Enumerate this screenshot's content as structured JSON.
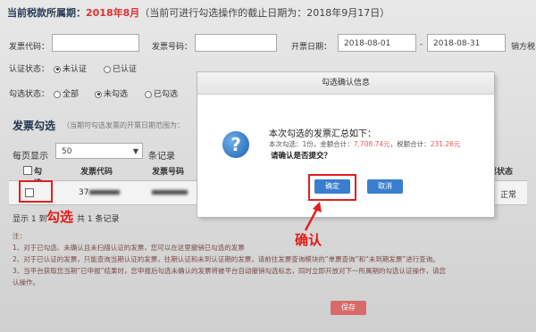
{
  "header": {
    "period_label": "当前税款所属期：",
    "period_value": "2018年8月",
    "period_note": "（当前可进行勾选操作的截止日期为：2018年9月17日）"
  },
  "filters": {
    "invoice_code_label": "发票代码：",
    "invoice_code_value": "",
    "invoice_number_label": "发票号码：",
    "invoice_number_value": "",
    "issue_date_label": "开票日期：",
    "date_from": "2018-08-01",
    "date_sep": "-",
    "date_to": "2018-08-31",
    "tax_id_label": "销方税",
    "auth_status_label": "认证状态：",
    "auth_options": [
      "未认证",
      "已认证"
    ],
    "check_status_label": "勾选状态：",
    "check_options": [
      "全部",
      "未勾选",
      "已勾选"
    ]
  },
  "section": {
    "title": "发票勾选",
    "note": "（当期可勾选发票的开票日期范围为：",
    "page_size_label": "每页显示",
    "page_size_value": "50",
    "page_size_suffix": "条记录"
  },
  "table": {
    "headers": [
      "勾选",
      "发票代码",
      "发票号码",
      "发票状态"
    ],
    "row_code": "37",
    "row_status": "正常",
    "footer_prefix": "显示 1 到",
    "footer_suffix": "共 1 条记录"
  },
  "annotations": {
    "check": "勾选",
    "confirm": "确认"
  },
  "notes": [
    "注：",
    "1、对于已勾选、未确认且未扫描认证的发票，您可以在这里撤销已勾选的发票",
    "2、对于已认证的发票，只能查询当期认证的发票，往期认证和未到认证期的发票，请前往发票查询模块的“单票查询”和“未到期发票”进行查询。",
    "3、当平台获取您当期“已申报”结果时，您申报后勾选未确认的发票将被平台自动撤销勾选标志，同时立即开放对下一所属期的勾选认证操作，请您",
    "认操作。"
  ],
  "save_label": "保存",
  "dialog": {
    "title": "勾选确认信息",
    "heading": "本次勾选的发票汇总如下：",
    "summary_prefix": "本次勾选：1份，金额合计：",
    "amount": "7,708.74元",
    "tax_prefix": "，税额合计：",
    "tax": "231.26元",
    "question": "请确认是否提交？",
    "ok_label": "确定",
    "cancel_label": "取消"
  },
  "colors": {
    "highlight_red": "#e02020",
    "button_blue": "#3a7ed0",
    "title_red": "#d33333"
  }
}
